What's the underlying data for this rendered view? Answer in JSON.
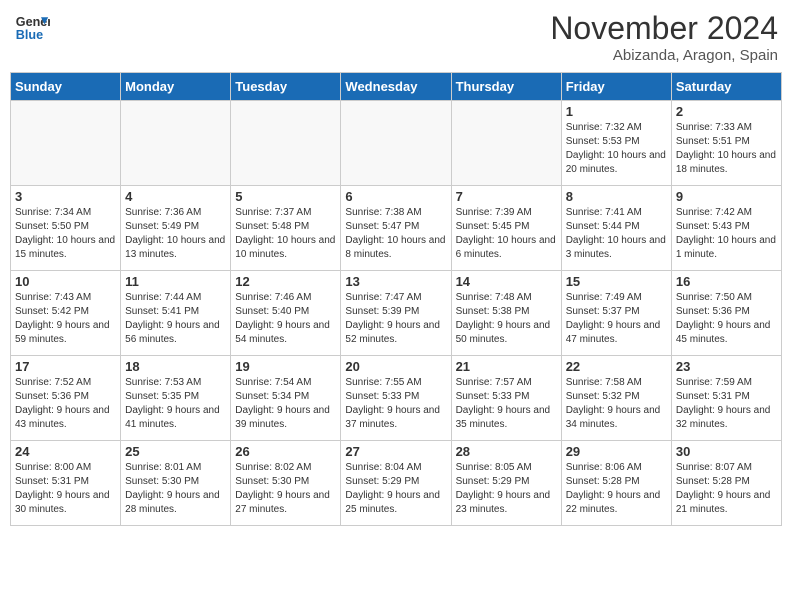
{
  "header": {
    "logo_line1": "General",
    "logo_line2": "Blue",
    "month": "November 2024",
    "location": "Abizanda, Aragon, Spain"
  },
  "weekdays": [
    "Sunday",
    "Monday",
    "Tuesday",
    "Wednesday",
    "Thursday",
    "Friday",
    "Saturday"
  ],
  "weeks": [
    [
      {
        "day": "",
        "info": ""
      },
      {
        "day": "",
        "info": ""
      },
      {
        "day": "",
        "info": ""
      },
      {
        "day": "",
        "info": ""
      },
      {
        "day": "",
        "info": ""
      },
      {
        "day": "1",
        "info": "Sunrise: 7:32 AM\nSunset: 5:53 PM\nDaylight: 10 hours and 20 minutes."
      },
      {
        "day": "2",
        "info": "Sunrise: 7:33 AM\nSunset: 5:51 PM\nDaylight: 10 hours and 18 minutes."
      }
    ],
    [
      {
        "day": "3",
        "info": "Sunrise: 7:34 AM\nSunset: 5:50 PM\nDaylight: 10 hours and 15 minutes."
      },
      {
        "day": "4",
        "info": "Sunrise: 7:36 AM\nSunset: 5:49 PM\nDaylight: 10 hours and 13 minutes."
      },
      {
        "day": "5",
        "info": "Sunrise: 7:37 AM\nSunset: 5:48 PM\nDaylight: 10 hours and 10 minutes."
      },
      {
        "day": "6",
        "info": "Sunrise: 7:38 AM\nSunset: 5:47 PM\nDaylight: 10 hours and 8 minutes."
      },
      {
        "day": "7",
        "info": "Sunrise: 7:39 AM\nSunset: 5:45 PM\nDaylight: 10 hours and 6 minutes."
      },
      {
        "day": "8",
        "info": "Sunrise: 7:41 AM\nSunset: 5:44 PM\nDaylight: 10 hours and 3 minutes."
      },
      {
        "day": "9",
        "info": "Sunrise: 7:42 AM\nSunset: 5:43 PM\nDaylight: 10 hours and 1 minute."
      }
    ],
    [
      {
        "day": "10",
        "info": "Sunrise: 7:43 AM\nSunset: 5:42 PM\nDaylight: 9 hours and 59 minutes."
      },
      {
        "day": "11",
        "info": "Sunrise: 7:44 AM\nSunset: 5:41 PM\nDaylight: 9 hours and 56 minutes."
      },
      {
        "day": "12",
        "info": "Sunrise: 7:46 AM\nSunset: 5:40 PM\nDaylight: 9 hours and 54 minutes."
      },
      {
        "day": "13",
        "info": "Sunrise: 7:47 AM\nSunset: 5:39 PM\nDaylight: 9 hours and 52 minutes."
      },
      {
        "day": "14",
        "info": "Sunrise: 7:48 AM\nSunset: 5:38 PM\nDaylight: 9 hours and 50 minutes."
      },
      {
        "day": "15",
        "info": "Sunrise: 7:49 AM\nSunset: 5:37 PM\nDaylight: 9 hours and 47 minutes."
      },
      {
        "day": "16",
        "info": "Sunrise: 7:50 AM\nSunset: 5:36 PM\nDaylight: 9 hours and 45 minutes."
      }
    ],
    [
      {
        "day": "17",
        "info": "Sunrise: 7:52 AM\nSunset: 5:36 PM\nDaylight: 9 hours and 43 minutes."
      },
      {
        "day": "18",
        "info": "Sunrise: 7:53 AM\nSunset: 5:35 PM\nDaylight: 9 hours and 41 minutes."
      },
      {
        "day": "19",
        "info": "Sunrise: 7:54 AM\nSunset: 5:34 PM\nDaylight: 9 hours and 39 minutes."
      },
      {
        "day": "20",
        "info": "Sunrise: 7:55 AM\nSunset: 5:33 PM\nDaylight: 9 hours and 37 minutes."
      },
      {
        "day": "21",
        "info": "Sunrise: 7:57 AM\nSunset: 5:33 PM\nDaylight: 9 hours and 35 minutes."
      },
      {
        "day": "22",
        "info": "Sunrise: 7:58 AM\nSunset: 5:32 PM\nDaylight: 9 hours and 34 minutes."
      },
      {
        "day": "23",
        "info": "Sunrise: 7:59 AM\nSunset: 5:31 PM\nDaylight: 9 hours and 32 minutes."
      }
    ],
    [
      {
        "day": "24",
        "info": "Sunrise: 8:00 AM\nSunset: 5:31 PM\nDaylight: 9 hours and 30 minutes."
      },
      {
        "day": "25",
        "info": "Sunrise: 8:01 AM\nSunset: 5:30 PM\nDaylight: 9 hours and 28 minutes."
      },
      {
        "day": "26",
        "info": "Sunrise: 8:02 AM\nSunset: 5:30 PM\nDaylight: 9 hours and 27 minutes."
      },
      {
        "day": "27",
        "info": "Sunrise: 8:04 AM\nSunset: 5:29 PM\nDaylight: 9 hours and 25 minutes."
      },
      {
        "day": "28",
        "info": "Sunrise: 8:05 AM\nSunset: 5:29 PM\nDaylight: 9 hours and 23 minutes."
      },
      {
        "day": "29",
        "info": "Sunrise: 8:06 AM\nSunset: 5:28 PM\nDaylight: 9 hours and 22 minutes."
      },
      {
        "day": "30",
        "info": "Sunrise: 8:07 AM\nSunset: 5:28 PM\nDaylight: 9 hours and 21 minutes."
      }
    ]
  ]
}
